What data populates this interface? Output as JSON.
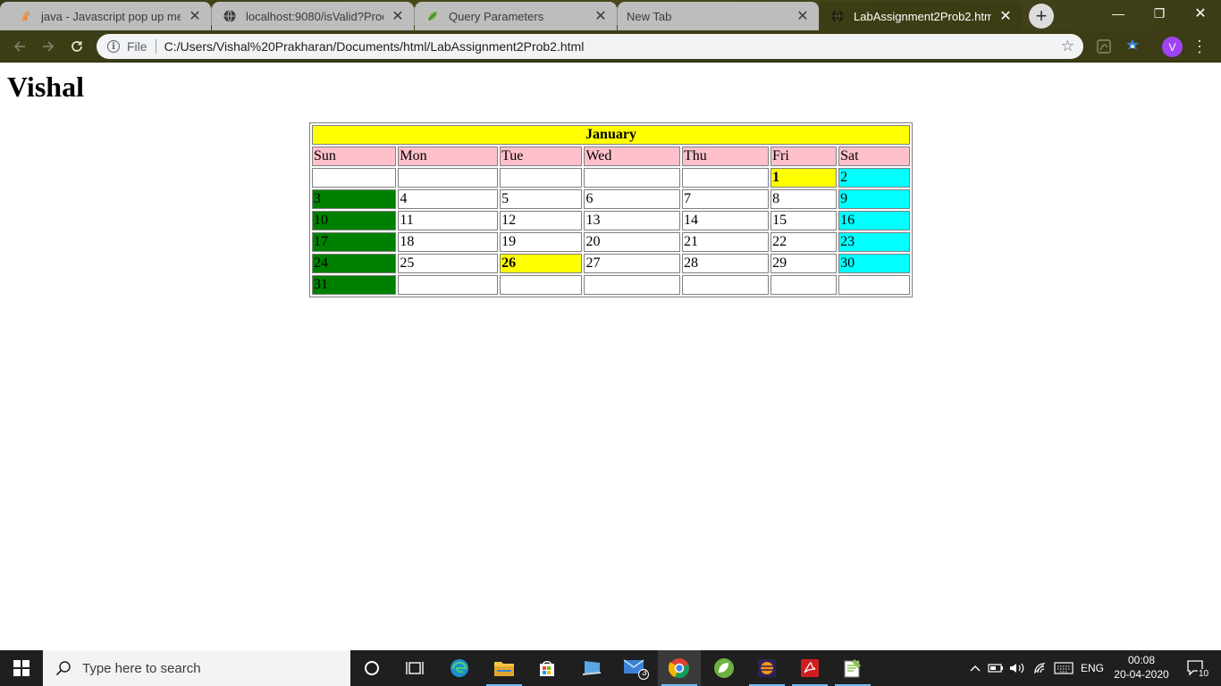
{
  "browser": {
    "tabs": [
      {
        "title": "java - Javascript pop up messa",
        "favicon": "stackoverflow-icon",
        "active": false
      },
      {
        "title": "localhost:9080/isValid?Product",
        "favicon": "globe-icon",
        "active": false
      },
      {
        "title": "Query Parameters",
        "favicon": "spring-leaf-icon",
        "active": false
      },
      {
        "title": "New Tab",
        "favicon": "",
        "active": false
      },
      {
        "title": "LabAssignment2Prob2.html",
        "favicon": "globe-icon",
        "active": true
      }
    ],
    "new_tab_symbol": "+",
    "window_controls": {
      "minimize": "—",
      "restore": "❐",
      "close": "✕"
    },
    "omnibox": {
      "scheme_label": "File",
      "url": "C:/Users/Vishal%20Prakharan/Documents/html/LabAssignment2Prob2.html"
    },
    "profile_initial": "V"
  },
  "page": {
    "heading": "Vishal",
    "calendar": {
      "month": "January",
      "weekdays": [
        "Sun",
        "Mon",
        "Tue",
        "Wed",
        "Thu",
        "Fri",
        "Sat"
      ],
      "weeks": [
        [
          "",
          "",
          "",
          "",
          "",
          "1",
          "2"
        ],
        [
          "3",
          "4",
          "5",
          "6",
          "7",
          "8",
          "9"
        ],
        [
          "10",
          "11",
          "12",
          "13",
          "14",
          "15",
          "16"
        ],
        [
          "17",
          "18",
          "19",
          "20",
          "21",
          "22",
          "23"
        ],
        [
          "24",
          "25",
          "26",
          "27",
          "28",
          "29",
          "30"
        ],
        [
          "31",
          "",
          "",
          "",
          "",
          "",
          ""
        ]
      ],
      "highlighted_days": [
        "1",
        "26"
      ],
      "colors": {
        "month_bg": "#ffff00",
        "weekday_bg": "#ffc0cb",
        "sunday_bg": "#008000",
        "saturday_bg": "#00ffff",
        "highlight_bg": "#ffff00"
      }
    }
  },
  "taskbar": {
    "search_placeholder": "Type here to search",
    "mail_badge": "3",
    "language": "ENG",
    "time": "00:08",
    "date": "20-04-2020",
    "notification_count": "10"
  }
}
